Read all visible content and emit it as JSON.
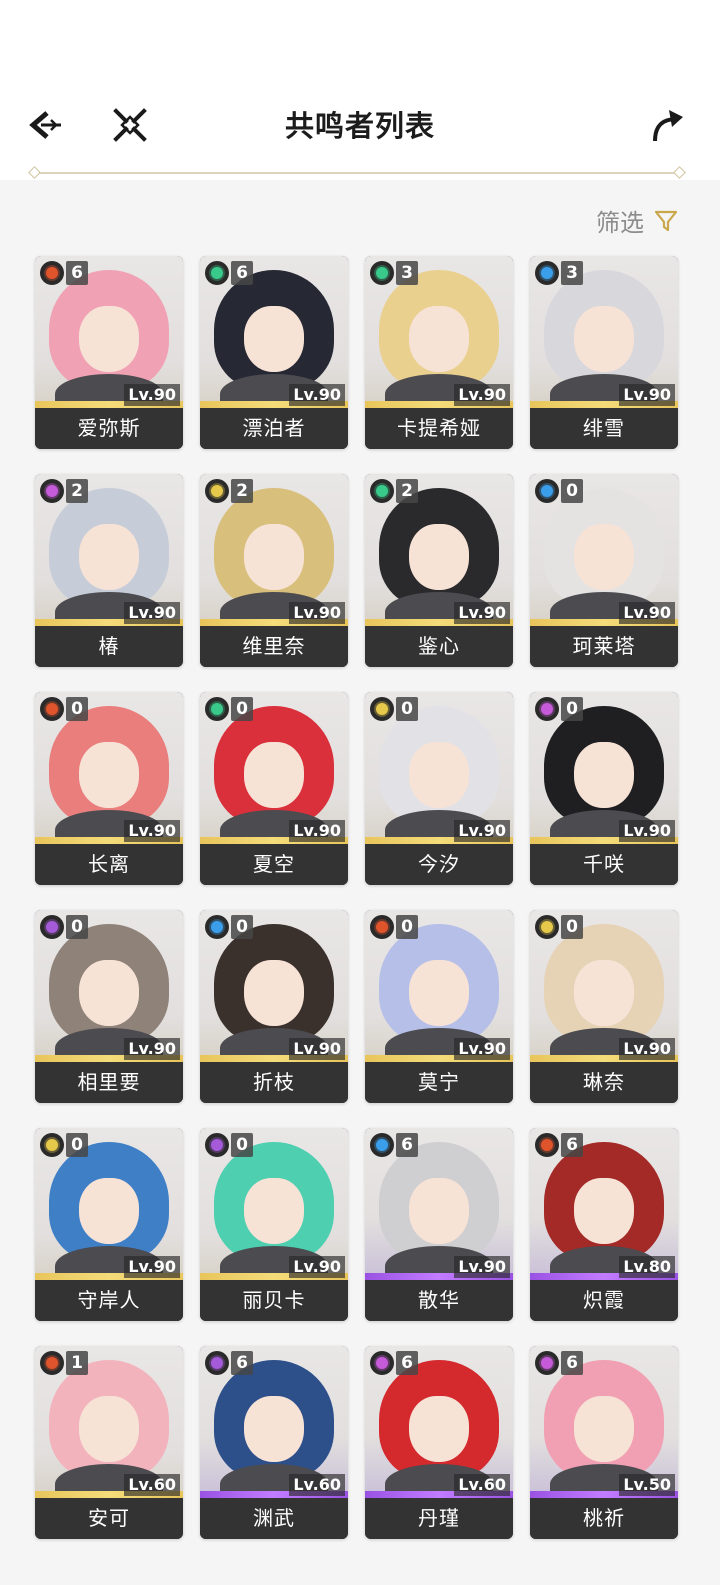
{
  "header": {
    "title": "共鸣者列表",
    "back_icon": "back-arrow-icon",
    "close_icon": "close-x-icon",
    "share_icon": "share-arrow-icon"
  },
  "filter": {
    "label": "筛选",
    "icon": "filter-funnel-icon",
    "color": "#c9a74a"
  },
  "elements": {
    "fusion": "#e0542c",
    "aero": "#39c98a",
    "glacio": "#3b9eea",
    "electro": "#c55bd8",
    "spectro": "#e6c84a",
    "havoc": "#a45ad9"
  },
  "characters": [
    {
      "name": "爱弥斯",
      "constellation": "6",
      "level": "Lv.90",
      "element": "fusion",
      "rarity": "gold",
      "hair": "#f0a2b4"
    },
    {
      "name": "漂泊者",
      "constellation": "6",
      "level": "Lv.90",
      "element": "aero",
      "rarity": "gold",
      "hair": "#262833"
    },
    {
      "name": "卡提希娅",
      "constellation": "3",
      "level": "Lv.90",
      "element": "aero",
      "rarity": "gold",
      "hair": "#ead08f"
    },
    {
      "name": "绯雪",
      "constellation": "3",
      "level": "Lv.90",
      "element": "glacio",
      "rarity": "gold",
      "hair": "#d8d8dc"
    },
    {
      "name": "椿",
      "constellation": "2",
      "level": "Lv.90",
      "element": "electro",
      "rarity": "gold",
      "hair": "#c7cdd8"
    },
    {
      "name": "维里奈",
      "constellation": "2",
      "level": "Lv.90",
      "element": "spectro",
      "rarity": "gold",
      "hair": "#d8bf7c"
    },
    {
      "name": "鉴心",
      "constellation": "2",
      "level": "Lv.90",
      "element": "aero",
      "rarity": "gold",
      "hair": "#2a2a2c"
    },
    {
      "name": "珂莱塔",
      "constellation": "0",
      "level": "Lv.90",
      "element": "glacio",
      "rarity": "gold",
      "hair": "#e5e3e2"
    },
    {
      "name": "长离",
      "constellation": "0",
      "level": "Lv.90",
      "element": "fusion",
      "rarity": "gold",
      "hair": "#e97e7c"
    },
    {
      "name": "夏空",
      "constellation": "0",
      "level": "Lv.90",
      "element": "aero",
      "rarity": "gold",
      "hair": "#d9303c"
    },
    {
      "name": "今汐",
      "constellation": "0",
      "level": "Lv.90",
      "element": "spectro",
      "rarity": "gold",
      "hair": "#e2e2e6"
    },
    {
      "name": "千咲",
      "constellation": "0",
      "level": "Lv.90",
      "element": "electro",
      "rarity": "gold",
      "hair": "#1f1f22"
    },
    {
      "name": "相里要",
      "constellation": "0",
      "level": "Lv.90",
      "element": "havoc",
      "rarity": "gold",
      "hair": "#8f8279"
    },
    {
      "name": "折枝",
      "constellation": "0",
      "level": "Lv.90",
      "element": "glacio",
      "rarity": "gold",
      "hair": "#3a302c"
    },
    {
      "name": "莫宁",
      "constellation": "0",
      "level": "Lv.90",
      "element": "fusion",
      "rarity": "gold",
      "hair": "#b6bfe8"
    },
    {
      "name": "琳奈",
      "constellation": "0",
      "level": "Lv.90",
      "element": "spectro",
      "rarity": "gold",
      "hair": "#e6d3b5"
    },
    {
      "name": "守岸人",
      "constellation": "0",
      "level": "Lv.90",
      "element": "spectro",
      "rarity": "gold",
      "hair": "#3e7fc6"
    },
    {
      "name": "丽贝卡",
      "constellation": "0",
      "level": "Lv.90",
      "element": "havoc",
      "rarity": "gold",
      "hair": "#4dcfb0"
    },
    {
      "name": "散华",
      "constellation": "6",
      "level": "Lv.90",
      "element": "glacio",
      "rarity": "purple",
      "hair": "#cfcfd2"
    },
    {
      "name": "炽霞",
      "constellation": "6",
      "level": "Lv.80",
      "element": "fusion",
      "rarity": "purple",
      "hair": "#a32a26"
    },
    {
      "name": "安可",
      "constellation": "1",
      "level": "Lv.60",
      "element": "fusion",
      "rarity": "gold",
      "hair": "#f2b3bd"
    },
    {
      "name": "渊武",
      "constellation": "6",
      "level": "Lv.60",
      "element": "havoc",
      "rarity": "purple",
      "hair": "#2d4f8a"
    },
    {
      "name": "丹瑾",
      "constellation": "6",
      "level": "Lv.60",
      "element": "electro",
      "rarity": "purple",
      "hair": "#d42a2e"
    },
    {
      "name": "桃祈",
      "constellation": "6",
      "level": "Lv.50",
      "element": "electro",
      "rarity": "purple",
      "hair": "#f0a0b2"
    }
  ]
}
